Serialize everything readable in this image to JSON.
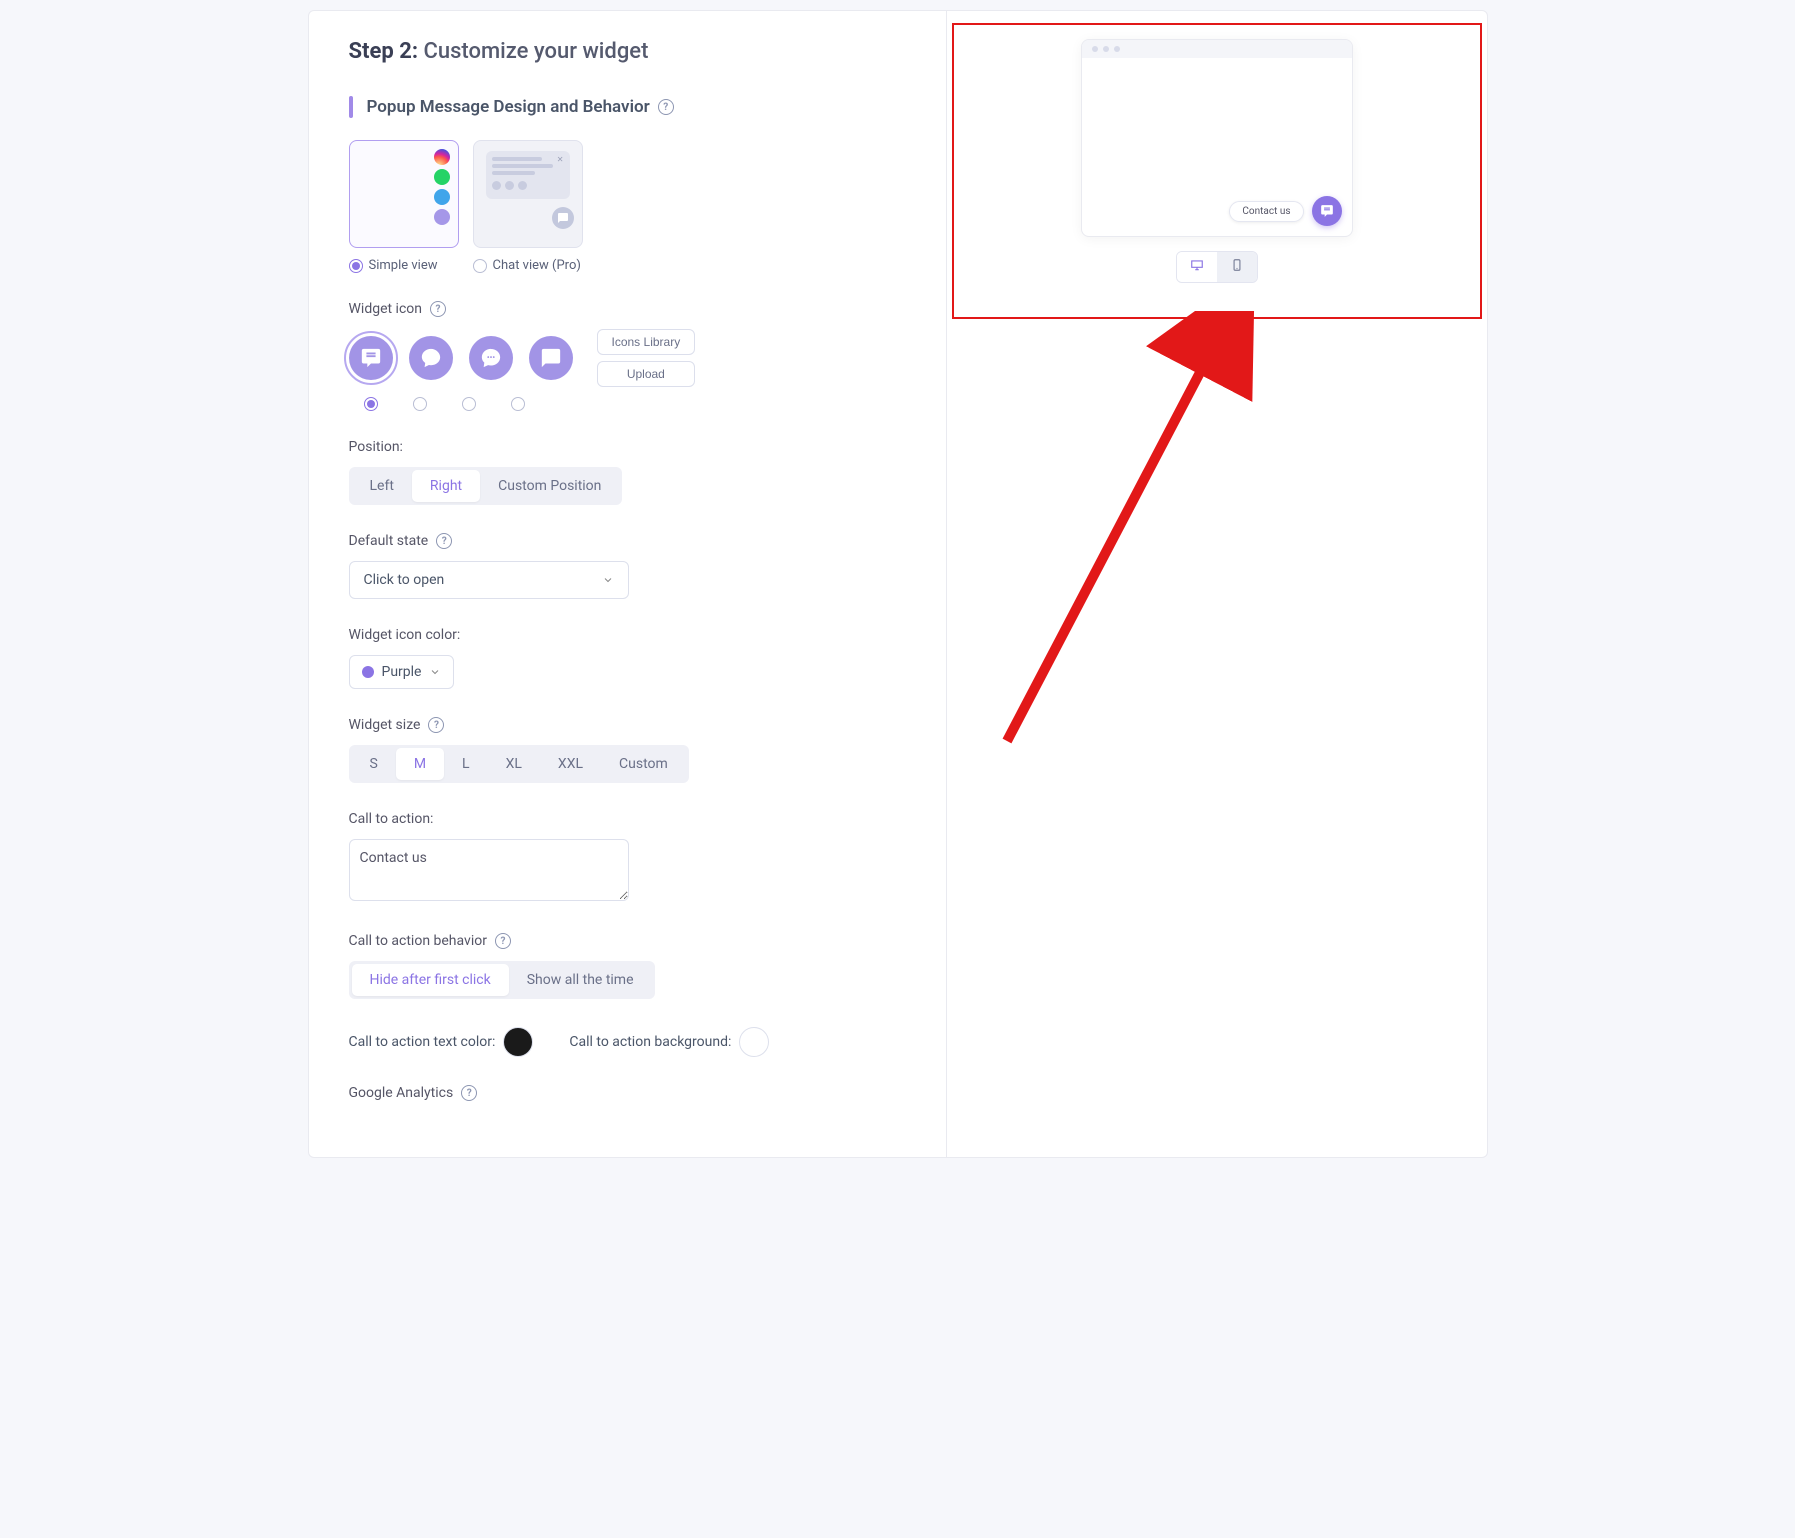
{
  "header": {
    "step_label": "Step 2:",
    "title": "Customize your widget"
  },
  "section": {
    "title": "Popup Message Design and Behavior"
  },
  "design": {
    "simple_label": "Simple view",
    "chat_label": "Chat view (Pro)"
  },
  "widget_icon": {
    "label": "Widget icon",
    "btn_library": "Icons Library",
    "btn_upload": "Upload"
  },
  "position": {
    "label": "Position:",
    "left": "Left",
    "right": "Right",
    "custom": "Custom Position"
  },
  "default_state": {
    "label": "Default state",
    "value": "Click to open"
  },
  "icon_color": {
    "label": "Widget icon color:",
    "value": "Purple",
    "hex": "#8b74e4"
  },
  "size": {
    "label": "Widget size",
    "options": [
      "S",
      "M",
      "L",
      "XL",
      "XXL",
      "Custom"
    ]
  },
  "cta": {
    "label": "Call to action:",
    "value": "Contact us"
  },
  "cta_behavior": {
    "label": "Call to action behavior",
    "hide": "Hide after first click",
    "show": "Show all the time"
  },
  "cta_text_color": {
    "label": "Call to action text color:",
    "value": "#1a1a1a"
  },
  "cta_bg": {
    "label": "Call to action background:",
    "value": "#ffffff"
  },
  "ga": {
    "label": "Google Analytics"
  },
  "preview": {
    "cta": "Contact us"
  }
}
